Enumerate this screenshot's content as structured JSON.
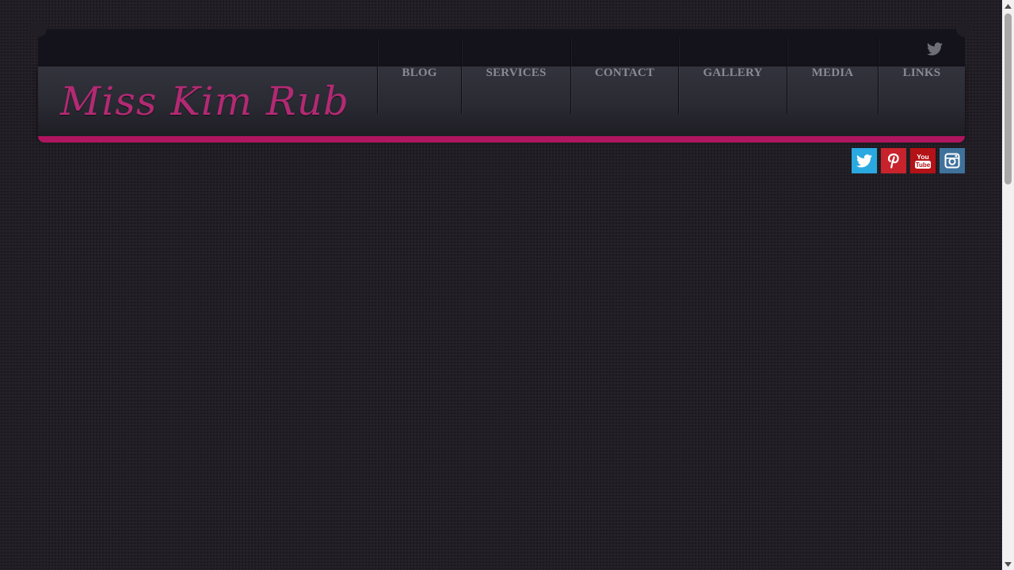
{
  "site": {
    "logo_text": "Miss Kim Rub"
  },
  "nav": {
    "items": [
      {
        "label": "BLOG"
      },
      {
        "label": "SERVICES"
      },
      {
        "label": "CONTACT"
      },
      {
        "label": "GALLERY"
      },
      {
        "label": "MEDIA"
      },
      {
        "label": "LINKS"
      }
    ]
  },
  "topbar": {
    "icon": "twitter-icon"
  },
  "social": [
    {
      "name": "twitter-icon",
      "color": "#2aa9e0"
    },
    {
      "name": "pinterest-icon",
      "color": "#c8232c"
    },
    {
      "name": "youtube-icon",
      "color": "#b31217"
    },
    {
      "name": "instagram-icon",
      "color": "#3f729b"
    }
  ],
  "colors": {
    "accent": "#b0155f",
    "logo": "#b22a73",
    "background": "#221e25",
    "nav_text": "#8a8a94"
  }
}
